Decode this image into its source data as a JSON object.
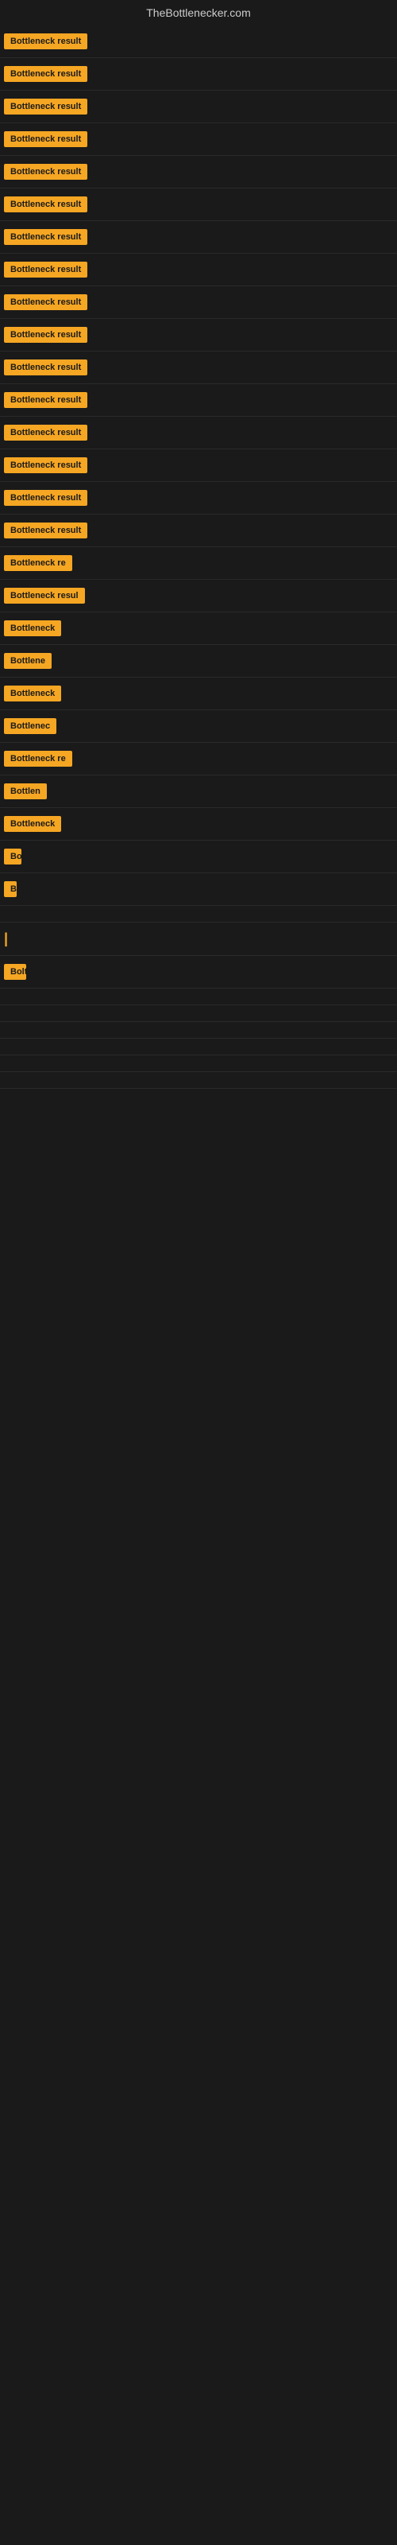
{
  "site": {
    "title": "TheBottlenecker.com"
  },
  "badges": [
    {
      "label": "Bottleneck result",
      "width": 120
    },
    {
      "label": "Bottleneck result",
      "width": 120
    },
    {
      "label": "Bottleneck result",
      "width": 120
    },
    {
      "label": "Bottleneck result",
      "width": 120
    },
    {
      "label": "Bottleneck result",
      "width": 120
    },
    {
      "label": "Bottleneck result",
      "width": 120
    },
    {
      "label": "Bottleneck result",
      "width": 120
    },
    {
      "label": "Bottleneck result",
      "width": 120
    },
    {
      "label": "Bottleneck result",
      "width": 120
    },
    {
      "label": "Bottleneck result",
      "width": 120
    },
    {
      "label": "Bottleneck result",
      "width": 120
    },
    {
      "label": "Bottleneck result",
      "width": 120
    },
    {
      "label": "Bottleneck result",
      "width": 120
    },
    {
      "label": "Bottleneck result",
      "width": 120
    },
    {
      "label": "Bottleneck result",
      "width": 120
    },
    {
      "label": "Bottleneck result",
      "width": 120
    },
    {
      "label": "Bottleneck re",
      "width": 90
    },
    {
      "label": "Bottleneck resul",
      "width": 105
    },
    {
      "label": "Bottleneck",
      "width": 78
    },
    {
      "label": "Bottlene",
      "width": 62
    },
    {
      "label": "Bottleneck",
      "width": 78
    },
    {
      "label": "Bottlenec",
      "width": 70
    },
    {
      "label": "Bottleneck re",
      "width": 90
    },
    {
      "label": "Bottlen",
      "width": 55
    },
    {
      "label": "Bottleneck",
      "width": 78
    },
    {
      "label": "Bo",
      "width": 22
    },
    {
      "label": "B",
      "width": 12
    },
    {
      "label": "",
      "width": 8
    },
    {
      "label": "|",
      "width": 6
    },
    {
      "label": "Bolt",
      "width": 28
    },
    {
      "label": "",
      "width": 0
    },
    {
      "label": "",
      "width": 0
    },
    {
      "label": "",
      "width": 0
    },
    {
      "label": "",
      "width": 0
    },
    {
      "label": "",
      "width": 0
    },
    {
      "label": "",
      "width": 0
    }
  ]
}
